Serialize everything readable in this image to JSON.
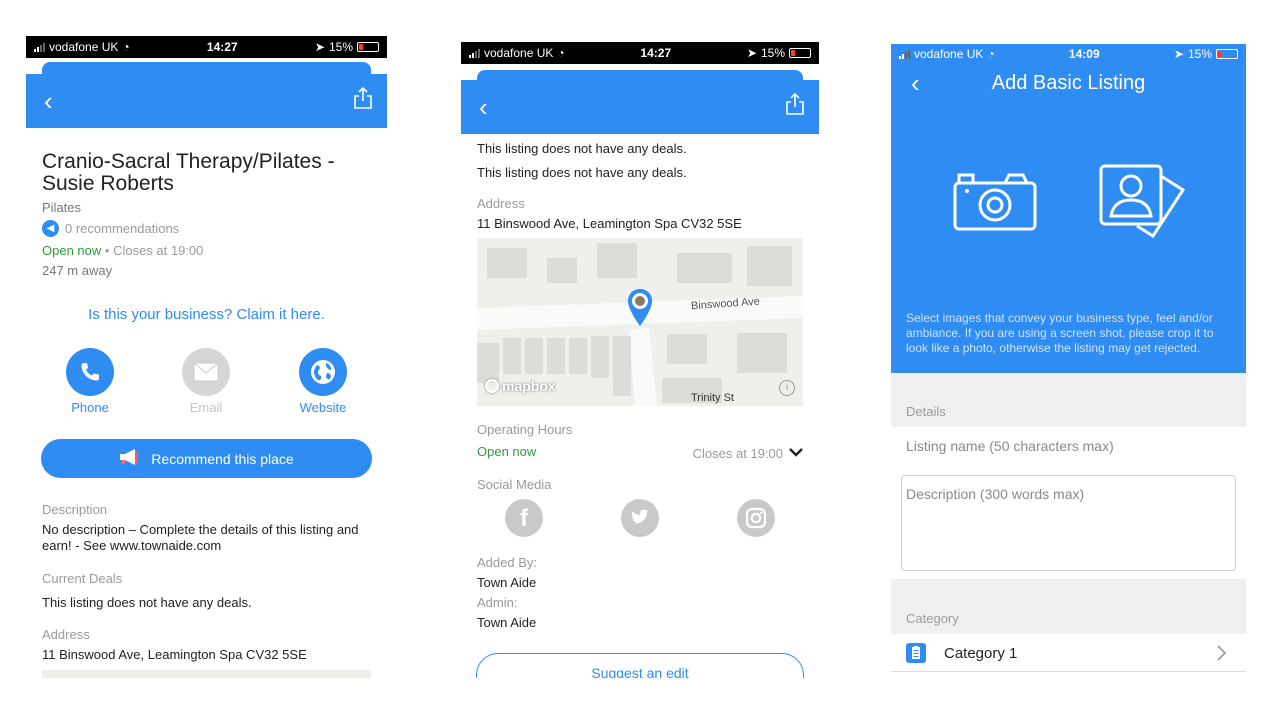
{
  "status": {
    "carrier": "vodafone UK",
    "time_left": "14:27",
    "time_mid": "14:27",
    "time_right": "14:09",
    "battery": "15%"
  },
  "screen1": {
    "title": "Cranio-Sacral Therapy/Pilates - Susie Roberts",
    "category": "Pilates",
    "recommendations": "0 recommendations",
    "open_now": "Open now",
    "closes": "Closes at 19:00",
    "distance": "247 m away",
    "claim": "Is this your business? Claim it here.",
    "actions": [
      {
        "label": "Phone",
        "enabled": true
      },
      {
        "label": "Email",
        "enabled": false
      },
      {
        "label": "Website",
        "enabled": true
      }
    ],
    "recommend_button": "Recommend this place",
    "description_label": "Description",
    "description": "No description – Complete the details of this listing and earn! - See www.townaide.com",
    "deals_label": "Current Deals",
    "deals": "This listing does not have any deals.",
    "address_label": "Address",
    "address": "11 Binswood Ave, Leamington Spa CV32 5SE"
  },
  "screen2": {
    "deals_1": "This listing does not have any deals.",
    "deals_2": "This listing does not have any deals.",
    "address_label": "Address",
    "address": "11 Binswood Ave, Leamington Spa CV32 5SE",
    "map": {
      "street_1": "Binswood Ave",
      "street_2": "Trinity St",
      "brand": "mapbox"
    },
    "hours_label": "Operating Hours",
    "open_now": "Open now",
    "closes": "Closes at 19:00",
    "social_label": "Social Media",
    "added_by_label": "Added By:",
    "added_by": "Town Aide",
    "admin_label": "Admin:",
    "admin": "Town Aide",
    "suggest_button": "Suggest an edit"
  },
  "screen3": {
    "title": "Add Basic Listing",
    "image_hint": "Select images that convey your business type, feel and/or ambiance. If you are using a screen shot, please crop it to look like a photo, otherwise the listing may get rejected.",
    "details_label": "Details",
    "name_placeholder": "Listing name (50 characters max)",
    "description_placeholder": "Description (300 words max)",
    "category_label": "Category",
    "category_item": "Category 1"
  },
  "colors": {
    "accent": "#2f8cf2",
    "open_green": "#2e9b3e",
    "muted": "#9a9a9a"
  }
}
